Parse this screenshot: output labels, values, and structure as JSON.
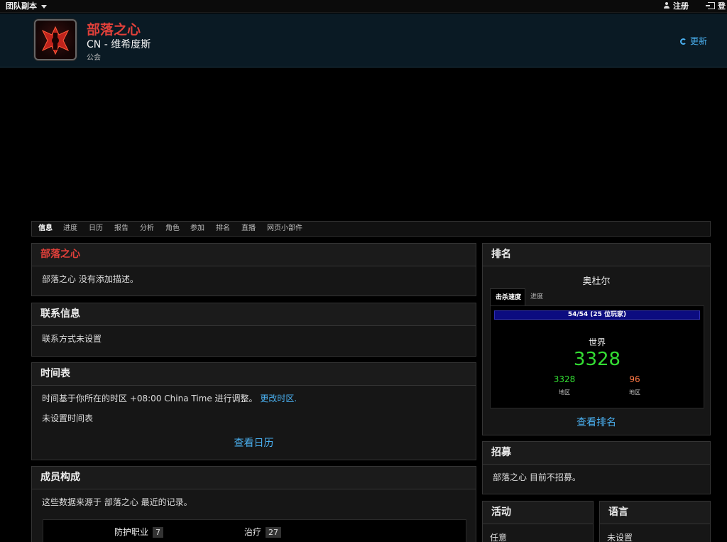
{
  "topbar": {
    "raid_menu": "团队副本",
    "register": "注册",
    "login": "登"
  },
  "guild": {
    "name": "部落之心",
    "realm": "CN - 维希度斯",
    "type": "公会",
    "update": "更新"
  },
  "tabs": [
    "信息",
    "进度",
    "日历",
    "报告",
    "分析",
    "角色",
    "参加",
    "排名",
    "直播",
    "网页小部件"
  ],
  "info_panel": {
    "title": "部落之心",
    "body": "部落之心 没有添加描述。"
  },
  "contact_panel": {
    "title": "联系信息",
    "body": "联系方式未设置"
  },
  "schedule_panel": {
    "title": "时间表",
    "timezone_text": "时间基于你所在的时区 +08:00 China Time 进行调整。",
    "change_tz": "更改时区.",
    "no_schedule": "未设置时间表",
    "view_calendar": "查看日历"
  },
  "members_panel": {
    "title": "成员构成",
    "source": "这些数据来源于 部落之心 最近的记录。",
    "roles": [
      {
        "label": "防护职业",
        "count": "7"
      },
      {
        "label": "治疗",
        "count": "27"
      }
    ]
  },
  "ranking_panel": {
    "title": "排名",
    "server": "奥杜尔",
    "tabs": [
      "击杀速度",
      "进度"
    ],
    "progress": "54/54 (25 位玩家)",
    "progress_fraction": 1.0,
    "world_label": "世界",
    "world_rank": "3328",
    "region_rank": "3328",
    "region_label": "地区",
    "realm_rank": "96",
    "realm_label": "地区",
    "view_rank": "查看排名",
    "colors": {
      "world": "#33dd33",
      "region": "#33dd33",
      "realm": "#ff7744"
    }
  },
  "recruit_panel": {
    "title": "招募",
    "body": "部落之心 目前不招募。"
  },
  "activity_panel": {
    "title": "活动",
    "value": "任意"
  },
  "language_panel": {
    "title": "语言",
    "value": "未设置"
  },
  "colors": {
    "accent_red": "#e0403a",
    "link_blue": "#4ab0f0",
    "header_bg": "#0a1a24"
  }
}
